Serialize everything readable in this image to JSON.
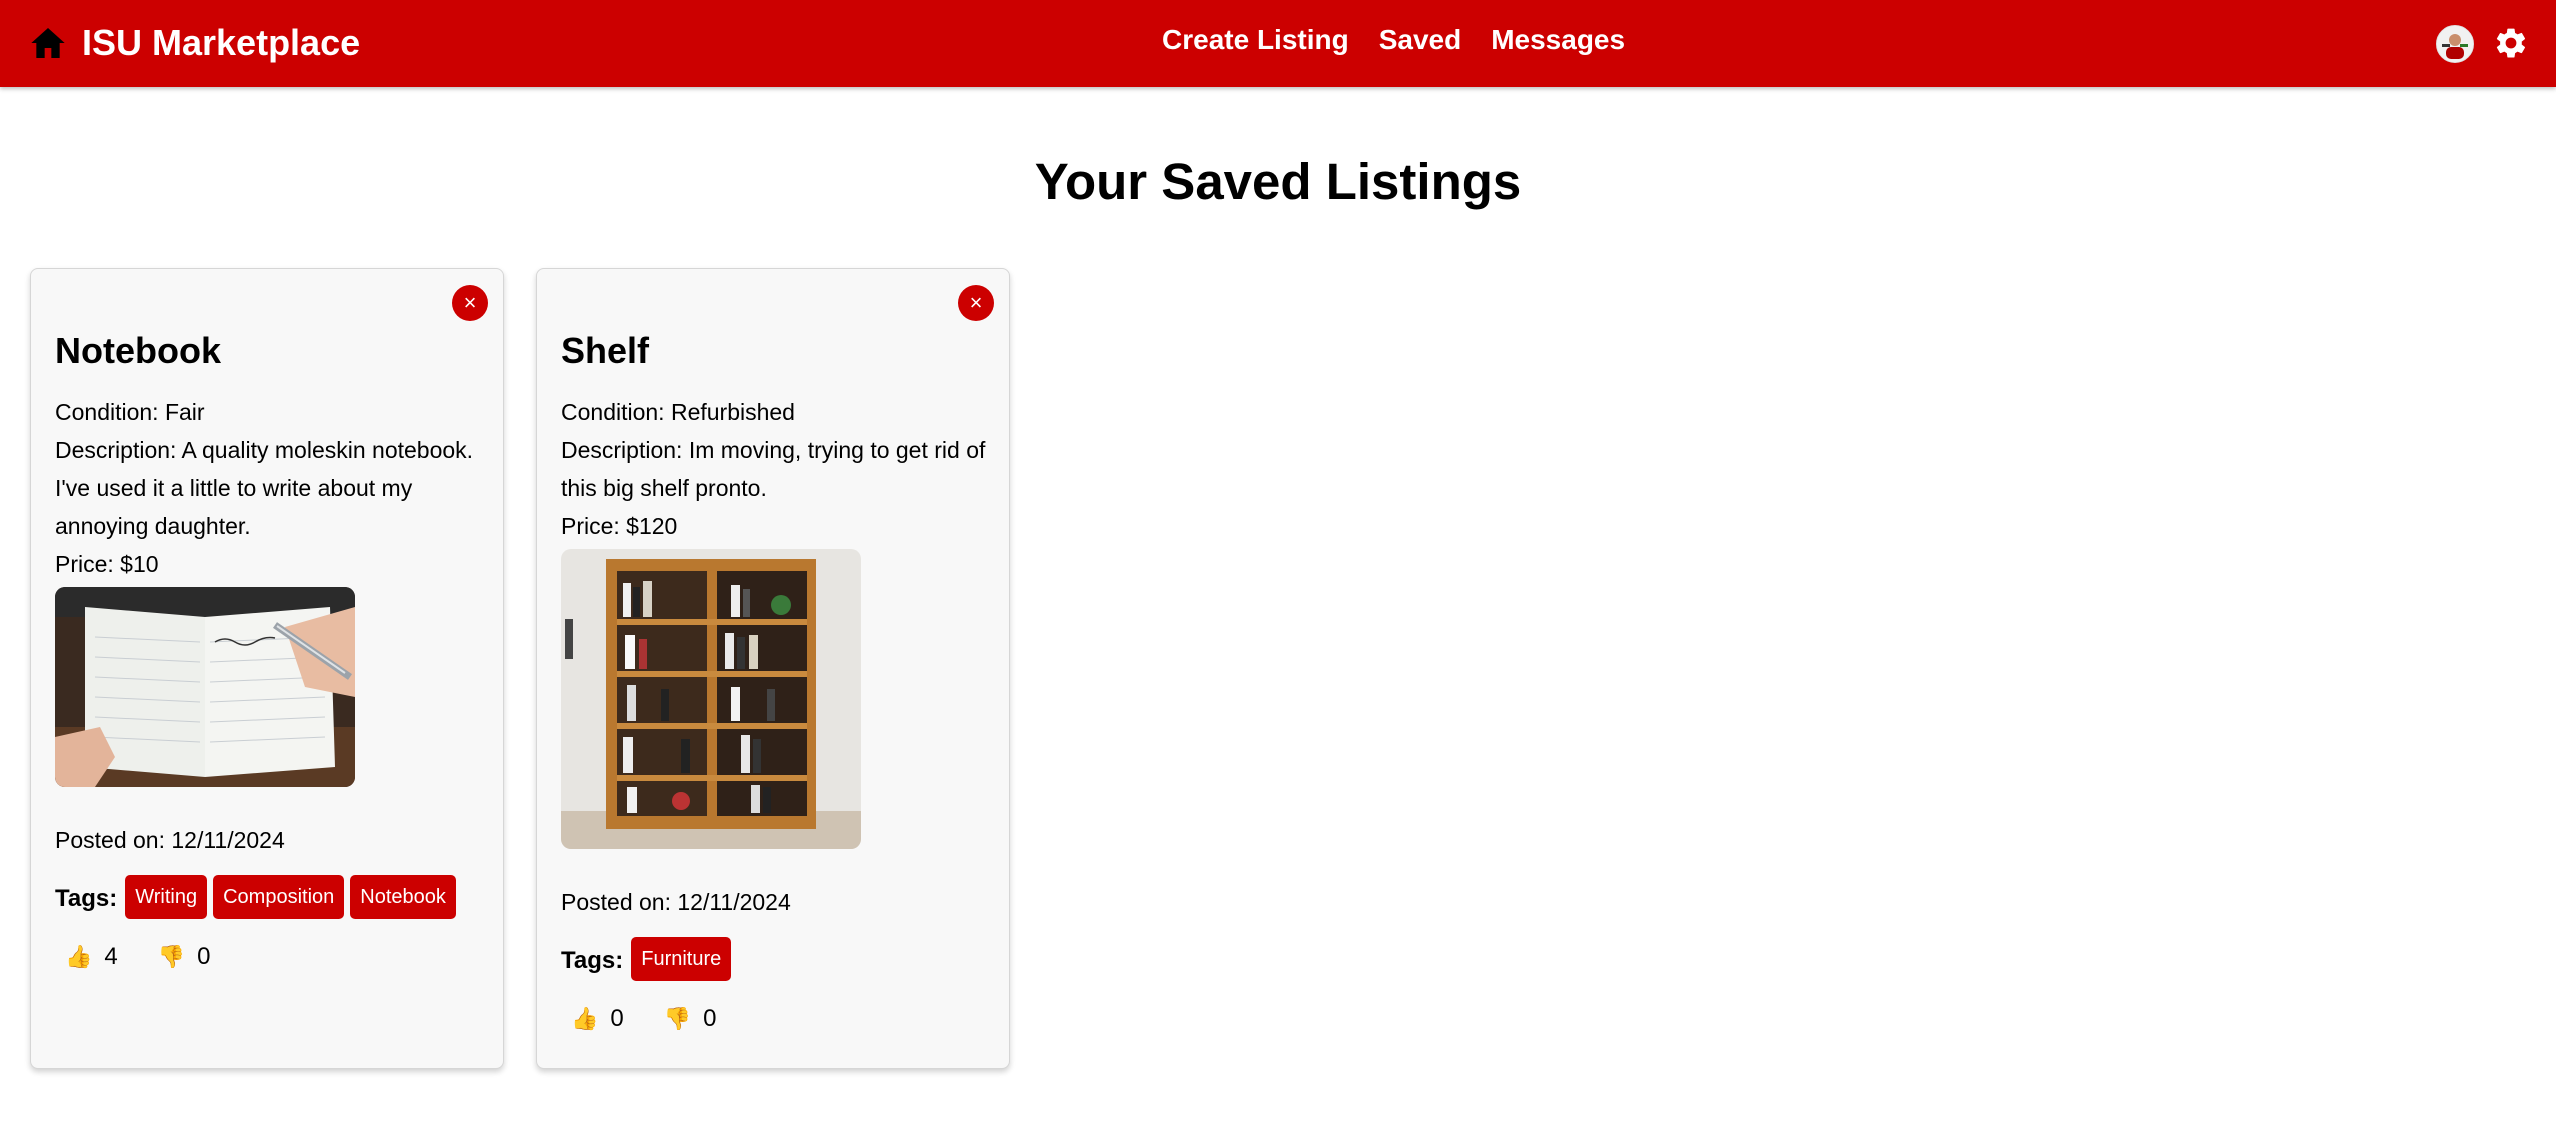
{
  "header": {
    "home_icon": "home-icon",
    "title": "ISU Marketplace",
    "nav": [
      "Create Listing",
      "Saved",
      "Messages"
    ],
    "avatar_icon": "user-avatar",
    "settings_icon": "gear-icon",
    "brand_color": "#cc0000"
  },
  "page": {
    "title": "Your Saved Listings"
  },
  "listings": [
    {
      "remove_symbol": "×",
      "title": "Notebook",
      "condition": "Condition: Fair",
      "description": "Description: A quality moleskin notebook. I've used it a little to write about my annoying daughter.",
      "price": "Price: $10",
      "posted": "Posted on: 12/11/2024",
      "tags_label": "Tags:",
      "tags": [
        "Writing",
        "Composition",
        "Notebook"
      ],
      "likes": "4",
      "dislikes": "0"
    },
    {
      "remove_symbol": "×",
      "title": "Shelf",
      "condition": "Condition: Refurbished",
      "description": "Description: Im moving, trying to get rid of this big shelf pronto.",
      "price": "Price: $120",
      "posted": "Posted on: 12/11/2024",
      "tags_label": "Tags:",
      "tags": [
        "Furniture"
      ],
      "likes": "0",
      "dislikes": "0"
    }
  ]
}
